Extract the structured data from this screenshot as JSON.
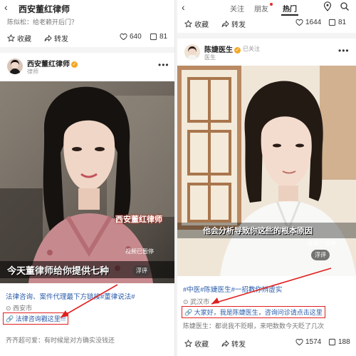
{
  "left": {
    "header_title": "西安董红律师",
    "prev_comment": "陈似松：给老赖开后门？",
    "prev_actions": {
      "collect": "收藏",
      "forward": "转发",
      "likes": "640",
      "comments": "81"
    },
    "author": {
      "name": "西安董红律师",
      "subtitle": "律师"
    },
    "video": {
      "watermark": "西安董红律师",
      "caption": "今天董律师给你提供七种",
      "paused": "视频已暂停",
      "fuping": "浮评"
    },
    "tags": "法律咨询、案件代理最下方链接#董律说法#",
    "location": "西安市",
    "link": "法律咨询戳这里!!!",
    "comment": "齐齐超可爱：有时候是对方确实没钱还"
  },
  "right": {
    "tabs": [
      "关注",
      "朋友",
      "热门"
    ],
    "active_tab": "热门",
    "prev_actions": {
      "collect": "收藏",
      "forward": "转发",
      "likes": "1644",
      "comments": "81"
    },
    "author": {
      "name": "陈婕医生",
      "subtitle": "医生",
      "followed": "已关注"
    },
    "video": {
      "caption": "他会分析导致你这些的根本原因",
      "paused": "视频已暂停",
      "fuping": "浮评"
    },
    "tags": "#中医#陈婕医生#一招教你辨虚实",
    "location": "武汉市",
    "link": "大家好，我是陈婕医生，咨询问诊请点击这里",
    "comment": "陈婕医生：都说我不贬眼，来吧数数今天眨了几次",
    "bottom_actions": {
      "collect": "收藏",
      "forward": "转发",
      "likes": "1574",
      "comments": "188"
    }
  },
  "colors": {
    "annotation_red": "#e02020",
    "link_blue": "#2a5caa"
  },
  "icons": [
    "back-arrow-icon",
    "location-icon",
    "search-icon",
    "star-icon",
    "forward-icon",
    "heart-icon",
    "comment-icon",
    "link-icon",
    "more-icon",
    "verified-icon"
  ]
}
